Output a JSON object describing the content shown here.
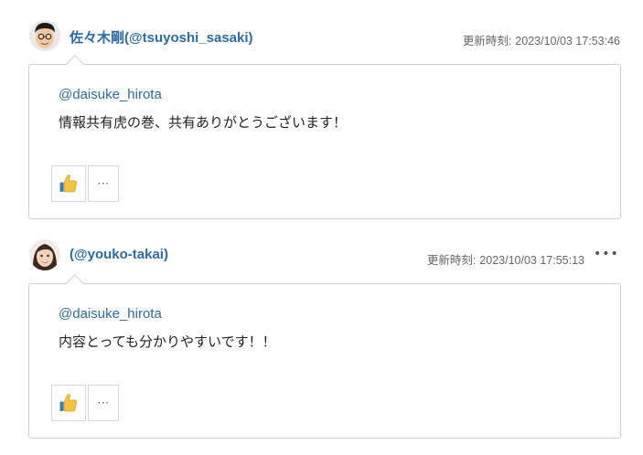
{
  "comments": [
    {
      "author": "佐々木剛(@tsuyoshi_sasaki)",
      "updated_label": "更新時刻:",
      "updated_time": "2023/10/03 17:53:46",
      "mention": "@daisuke_hirota",
      "text": "情報共有虎の巻、共有ありがとうございます！",
      "more_label": "···",
      "avatar": "avatar-man",
      "like_icon": "thumbs-up-icon"
    },
    {
      "author": "(@youko-takai)",
      "updated_label": "更新時刻:",
      "updated_time": "2023/10/03 17:55:13",
      "menu_label": "•••",
      "mention": "@daisuke_hirota",
      "text": "内容とっても分かりやすいです！！",
      "more_label": "···",
      "avatar": "avatar-woman",
      "like_icon": "thumbs-up-icon"
    }
  ],
  "colors": {
    "link": "#2b6ca3",
    "border": "#cfcfcf",
    "thumb": "#f5c242"
  }
}
